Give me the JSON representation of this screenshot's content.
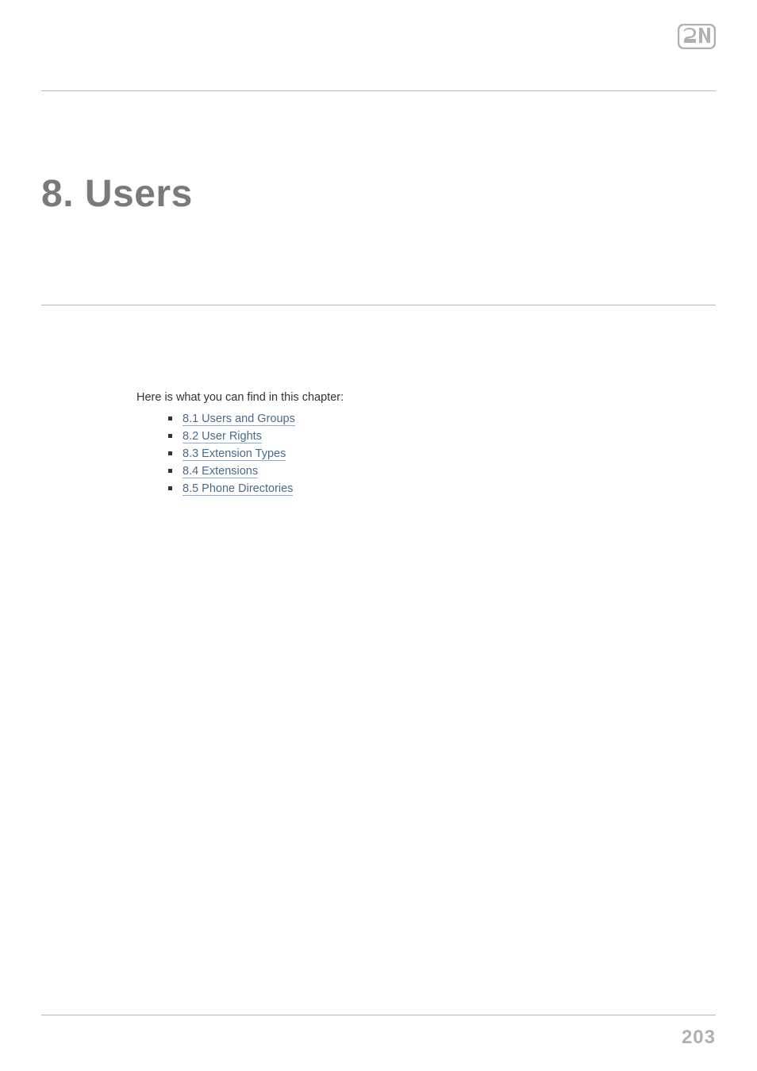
{
  "logo": {
    "text": "2N"
  },
  "title": "8. Users",
  "intro": "Here is what you can find in this chapter:",
  "links": [
    {
      "label": "8.1 Users and Groups"
    },
    {
      "label": "8.2 User Rights"
    },
    {
      "label": "8.3 Extension Types"
    },
    {
      "label": "8.4 Extensions"
    },
    {
      "label": "8.5 Phone Directories"
    }
  ],
  "page_number": "203"
}
